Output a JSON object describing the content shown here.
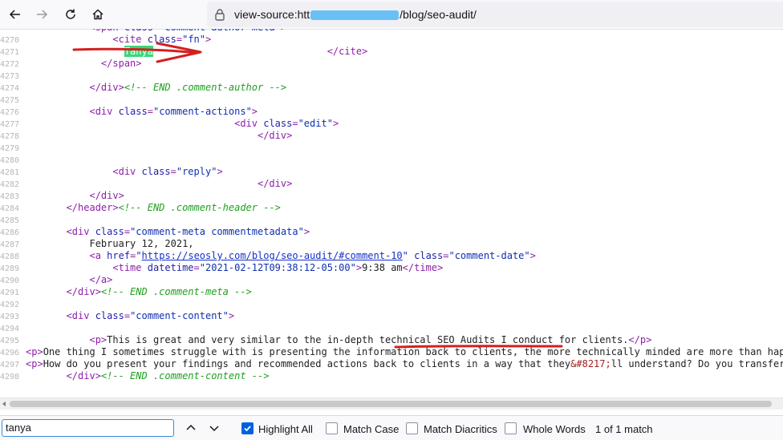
{
  "toolbar": {
    "url_prefix": "view-source:htt",
    "url_suffix": "/blog/seo-audit/"
  },
  "source_lines": [
    {
      "n": "4270",
      "indent": "               ",
      "parts": [
        {
          "c": "tag",
          "t": "<cite "
        },
        {
          "c": "attr",
          "t": "class"
        },
        {
          "c": "tag",
          "t": "="
        },
        {
          "c": "val",
          "t": "\"fn\""
        },
        {
          "c": "tag",
          "t": ">"
        }
      ]
    },
    {
      "n": "4271",
      "indent": "                 ",
      "parts": [
        {
          "c": "hl",
          "t": "Tanya"
        },
        {
          "c": "txt",
          "t": "                              "
        },
        {
          "c": "tag",
          "t": "</cite>"
        }
      ]
    },
    {
      "n": "4272",
      "indent": "             ",
      "parts": [
        {
          "c": "tag",
          "t": "</span>"
        }
      ]
    },
    {
      "n": "4273",
      "indent": "",
      "parts": []
    },
    {
      "n": "4274",
      "indent": "           ",
      "parts": [
        {
          "c": "tag",
          "t": "</div>"
        },
        {
          "c": "com",
          "t": "<!-- END .comment-author -->"
        }
      ]
    },
    {
      "n": "4275",
      "indent": "",
      "parts": []
    },
    {
      "n": "4276",
      "indent": "           ",
      "parts": [
        {
          "c": "tag",
          "t": "<div "
        },
        {
          "c": "attr",
          "t": "class"
        },
        {
          "c": "tag",
          "t": "="
        },
        {
          "c": "val",
          "t": "\"comment-actions\""
        },
        {
          "c": "tag",
          "t": ">"
        }
      ]
    },
    {
      "n": "4277",
      "indent": "                                    ",
      "parts": [
        {
          "c": "tag",
          "t": "<div "
        },
        {
          "c": "attr",
          "t": "class"
        },
        {
          "c": "tag",
          "t": "="
        },
        {
          "c": "val",
          "t": "\"edit\""
        },
        {
          "c": "tag",
          "t": ">"
        }
      ]
    },
    {
      "n": "4278",
      "indent": "                                        ",
      "parts": [
        {
          "c": "tag",
          "t": "</div>"
        }
      ]
    },
    {
      "n": "4279",
      "indent": "",
      "parts": []
    },
    {
      "n": "4280",
      "indent": "",
      "parts": []
    },
    {
      "n": "4281",
      "indent": "               ",
      "parts": [
        {
          "c": "tag",
          "t": "<div "
        },
        {
          "c": "attr",
          "t": "class"
        },
        {
          "c": "tag",
          "t": "="
        },
        {
          "c": "val",
          "t": "\"reply\""
        },
        {
          "c": "tag",
          "t": ">"
        }
      ]
    },
    {
      "n": "4282",
      "indent": "                                        ",
      "parts": [
        {
          "c": "tag",
          "t": "</div>"
        }
      ]
    },
    {
      "n": "4283",
      "indent": "           ",
      "parts": [
        {
          "c": "tag",
          "t": "</div>"
        }
      ]
    },
    {
      "n": "4284",
      "indent": "       ",
      "parts": [
        {
          "c": "tag",
          "t": "</header>"
        },
        {
          "c": "com",
          "t": "<!-- END .comment-header -->"
        }
      ]
    },
    {
      "n": "4285",
      "indent": "",
      "parts": []
    },
    {
      "n": "4286",
      "indent": "       ",
      "parts": [
        {
          "c": "tag",
          "t": "<div "
        },
        {
          "c": "attr",
          "t": "class"
        },
        {
          "c": "tag",
          "t": "="
        },
        {
          "c": "val",
          "t": "\"comment-meta commentmetadata\""
        },
        {
          "c": "tag",
          "t": ">"
        }
      ]
    },
    {
      "n": "4287",
      "indent": "           ",
      "parts": [
        {
          "c": "txt",
          "t": "February 12, 2021,"
        }
      ]
    },
    {
      "n": "4288",
      "indent": "           ",
      "parts": [
        {
          "c": "tag",
          "t": "<a "
        },
        {
          "c": "attr",
          "t": "href"
        },
        {
          "c": "tag",
          "t": "="
        },
        {
          "c": "val",
          "t": "\""
        },
        {
          "c": "lnk",
          "t": "https://seosly.com/blog/seo-audit/#comment-10"
        },
        {
          "c": "val",
          "t": "\""
        },
        {
          "c": "txt",
          "t": " "
        },
        {
          "c": "attr",
          "t": "class"
        },
        {
          "c": "tag",
          "t": "="
        },
        {
          "c": "val",
          "t": "\"comment-date\""
        },
        {
          "c": "tag",
          "t": ">"
        }
      ]
    },
    {
      "n": "4289",
      "indent": "               ",
      "parts": [
        {
          "c": "tag",
          "t": "<time "
        },
        {
          "c": "attr",
          "t": "datetime"
        },
        {
          "c": "tag",
          "t": "="
        },
        {
          "c": "val",
          "t": "\"2021-02-12T09:38:12-05:00\""
        },
        {
          "c": "tag",
          "t": ">"
        },
        {
          "c": "txt",
          "t": "9:38 am"
        },
        {
          "c": "tag",
          "t": "</time>"
        }
      ]
    },
    {
      "n": "4290",
      "indent": "           ",
      "parts": [
        {
          "c": "tag",
          "t": "</a>"
        }
      ]
    },
    {
      "n": "4291",
      "indent": "       ",
      "parts": [
        {
          "c": "tag",
          "t": "</div>"
        },
        {
          "c": "com",
          "t": "<!-- END .comment-meta -->"
        }
      ]
    },
    {
      "n": "4292",
      "indent": "",
      "parts": []
    },
    {
      "n": "4293",
      "indent": "       ",
      "parts": [
        {
          "c": "tag",
          "t": "<div "
        },
        {
          "c": "attr",
          "t": "class"
        },
        {
          "c": "tag",
          "t": "="
        },
        {
          "c": "val",
          "t": "\"comment-content\""
        },
        {
          "c": "tag",
          "t": ">"
        }
      ]
    },
    {
      "n": "4294",
      "indent": "",
      "parts": []
    },
    {
      "n": "4295",
      "indent": "           ",
      "parts": [
        {
          "c": "tag",
          "t": "<p>"
        },
        {
          "c": "txt",
          "t": "This is great and very similar to the in-depth technical SEO Audits I conduct for clients."
        },
        {
          "c": "tag",
          "t": "</p>"
        }
      ]
    },
    {
      "n": "4296",
      "indent": "",
      "parts": [
        {
          "c": "tag",
          "t": "<p>"
        },
        {
          "c": "txt",
          "t": "One thing I sometimes struggle with is presenting the information back to clients, the more technically minded are more than happy with"
        }
      ]
    },
    {
      "n": "4297",
      "indent": "",
      "parts": [
        {
          "c": "tag",
          "t": "<p>"
        },
        {
          "c": "txt",
          "t": "How do you present your findings and recommended actions back to clients in a way that they"
        },
        {
          "c": "ent",
          "t": "&#8217;"
        },
        {
          "c": "txt",
          "t": "ll understand? Do you transfer all"
        }
      ]
    },
    {
      "n": "4298",
      "indent": "       ",
      "parts": [
        {
          "c": "tag",
          "t": "</div>"
        },
        {
          "c": "com",
          "t": "<!-- END .comment-content -->"
        }
      ]
    }
  ],
  "findbar": {
    "query": "tanya",
    "highlight_all": "Highlight All",
    "match_case": "Match Case",
    "match_diacritics": "Match Diacritics",
    "whole_words": "Whole Words",
    "status": "1 of 1 match",
    "highlight_all_checked": true
  },
  "colors": {
    "highlight": "#38d878",
    "annotation": "#d42020",
    "accent": "#0061e0"
  }
}
